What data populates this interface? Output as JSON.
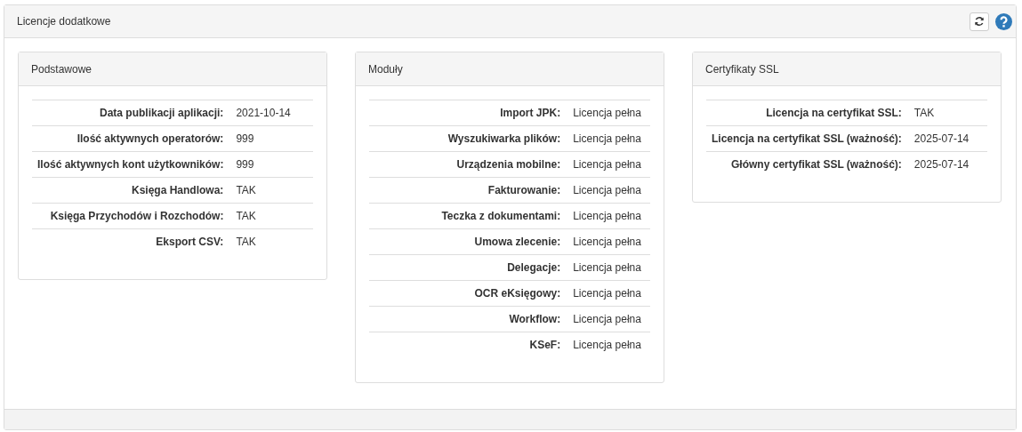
{
  "panel": {
    "title": "Licencje dodatkowe",
    "buttons": [
      {
        "kind": "refresh"
      },
      {
        "kind": "help"
      }
    ]
  },
  "cards": [
    {
      "title": "Podstawowe",
      "rows": [
        {
          "label": "Data publikacji aplikacji:",
          "value": "2021-10-14"
        },
        {
          "label": "Ilość aktywnych operatorów:",
          "value": "999"
        },
        {
          "label": "Ilość aktywnych kont użytkowników:",
          "value": "999"
        },
        {
          "label": "Księga Handlowa:",
          "value": "TAK"
        },
        {
          "label": "Księga Przychodów i Rozchodów:",
          "value": "TAK"
        },
        {
          "label": "Eksport CSV:",
          "value": "TAK"
        }
      ]
    },
    {
      "title": "Moduły",
      "rows": [
        {
          "label": "Import JPK:",
          "value": "Licencja pełna"
        },
        {
          "label": "Wyszukiwarka plików:",
          "value": "Licencja pełna"
        },
        {
          "label": "Urządzenia mobilne:",
          "value": "Licencja pełna"
        },
        {
          "label": "Fakturowanie:",
          "value": "Licencja pełna"
        },
        {
          "label": "Teczka z dokumentami:",
          "value": "Licencja pełna"
        },
        {
          "label": "Umowa zlecenie:",
          "value": "Licencja pełna"
        },
        {
          "label": "Delegacje:",
          "value": "Licencja pełna"
        },
        {
          "label": "OCR eKsięgowy:",
          "value": "Licencja pełna"
        },
        {
          "label": "Workflow:",
          "value": "Licencja pełna"
        },
        {
          "label": "KSeF:",
          "value": "Licencja pełna"
        }
      ]
    },
    {
      "title": "Certyfikaty SSL",
      "rows": [
        {
          "label": "Licencja na certyfikat SSL:",
          "value": "TAK"
        },
        {
          "label": "Licencja na certyfikat SSL (ważność):",
          "value": "2025-07-14"
        },
        {
          "label": "Główny certyfikat SSL (ważność):",
          "value": "2025-07-14"
        }
      ]
    }
  ]
}
